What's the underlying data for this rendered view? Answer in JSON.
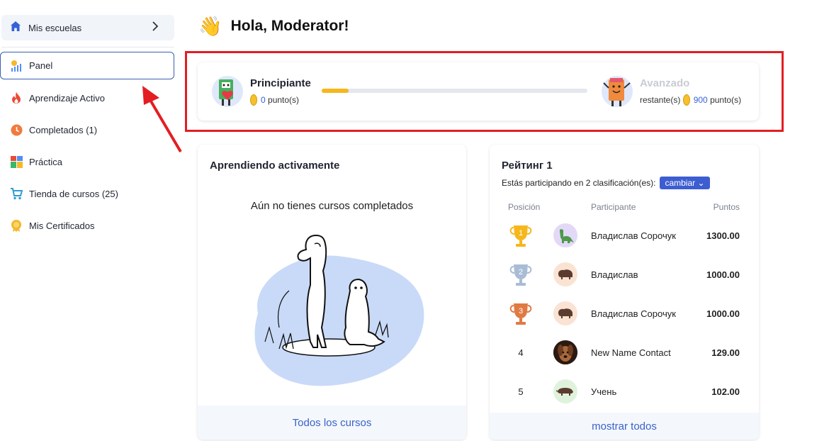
{
  "sidebar": {
    "schools_label": "Mis escuelas",
    "items": [
      {
        "label": "Panel"
      },
      {
        "label": "Aprendizaje Activo"
      },
      {
        "label": "Completados (1)"
      },
      {
        "label": "Práctica"
      },
      {
        "label": "Tienda de cursos (25)"
      },
      {
        "label": "Mis Certificados"
      }
    ]
  },
  "header": {
    "greeting": "Hola, Moderator!",
    "emoji": "👋"
  },
  "level": {
    "current_name": "Principiante",
    "current_points": "0",
    "points_suffix": "punto(s)",
    "progress_fraction": 0.1,
    "next_name": "Avanzado",
    "remaining_prefix": "restante(s)",
    "remaining_points": "900"
  },
  "active_learning": {
    "title": "Aprendiendo activamente",
    "empty_message": "Aún no tienes cursos completados",
    "footer_link": "Todos los cursos"
  },
  "rating": {
    "title": "Рейтинг 1",
    "subtitle": "Estás participando en 2 clasificación(es):",
    "change_button": "cambiar",
    "columns": {
      "position": "Posición",
      "participant": "Participante",
      "points": "Puntos"
    },
    "rows": [
      {
        "position": "1",
        "name": "Владислав Сорочук",
        "points": "1300.00"
      },
      {
        "position": "2",
        "name": "Владислав",
        "points": "1000.00"
      },
      {
        "position": "3",
        "name": "Владислав Сорочук",
        "points": "1000.00"
      },
      {
        "position": "4",
        "name": "New Name Contact",
        "points": "129.00"
      },
      {
        "position": "5",
        "name": "Учень",
        "points": "102.00"
      }
    ],
    "footer_link": "mostrar todos"
  },
  "colors": {
    "highlight": "#e21e23",
    "accent": "#3d5ed1",
    "gold": "#f6b71d",
    "silver": "#a9bcd6",
    "bronze": "#e07a43"
  }
}
